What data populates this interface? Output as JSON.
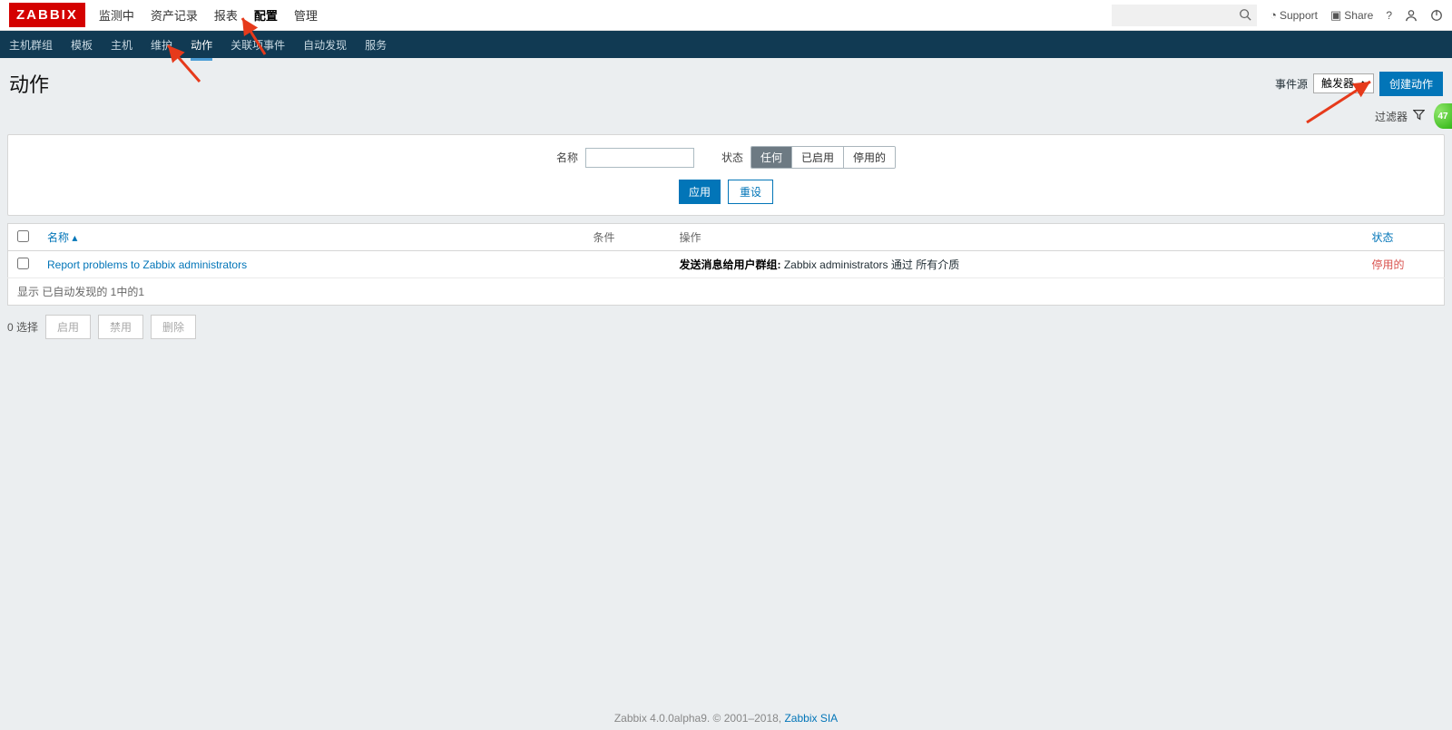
{
  "logo": "ZABBIX",
  "topnav": {
    "items": [
      {
        "label": "监测中",
        "active": false
      },
      {
        "label": "资产记录",
        "active": false
      },
      {
        "label": "报表",
        "active": false
      },
      {
        "label": "配置",
        "active": true
      },
      {
        "label": "管理",
        "active": false
      }
    ],
    "support": "Support",
    "share": "Share"
  },
  "subnav": {
    "items": [
      {
        "label": "主机群组",
        "active": false
      },
      {
        "label": "模板",
        "active": false
      },
      {
        "label": "主机",
        "active": false
      },
      {
        "label": "维护",
        "active": false
      },
      {
        "label": "动作",
        "active": true
      },
      {
        "label": "关联项事件",
        "active": false
      },
      {
        "label": "自动发现",
        "active": false
      },
      {
        "label": "服务",
        "active": false
      }
    ]
  },
  "page": {
    "title": "动作",
    "event_source_label": "事件源",
    "event_source_value": "触发器",
    "create_btn": "创建动作",
    "filter_label": "过滤器",
    "badge": "47"
  },
  "filter": {
    "name_label": "名称",
    "name_value": "",
    "status_label": "状态",
    "status_options": [
      "任何",
      "已启用",
      "停用的"
    ],
    "apply_btn": "应用",
    "reset_btn": "重设"
  },
  "table": {
    "columns": {
      "name": "名称",
      "sort_indicator": "▴",
      "condition": "条件",
      "operation": "操作",
      "status": "状态"
    },
    "rows": [
      {
        "name": "Report problems to Zabbix administrators",
        "condition": "",
        "op_bold": "发送消息给用户群组:",
        "op_rest": " Zabbix administrators 通过 所有介质",
        "status": "停用的"
      }
    ],
    "footer": "显示 已自动发现的 1中的1"
  },
  "bulk": {
    "selected": "0 选择",
    "enable": "启用",
    "disable": "禁用",
    "delete": "删除"
  },
  "footer": {
    "text": "Zabbix 4.0.0alpha9. © 2001–2018, ",
    "link": "Zabbix SIA"
  }
}
